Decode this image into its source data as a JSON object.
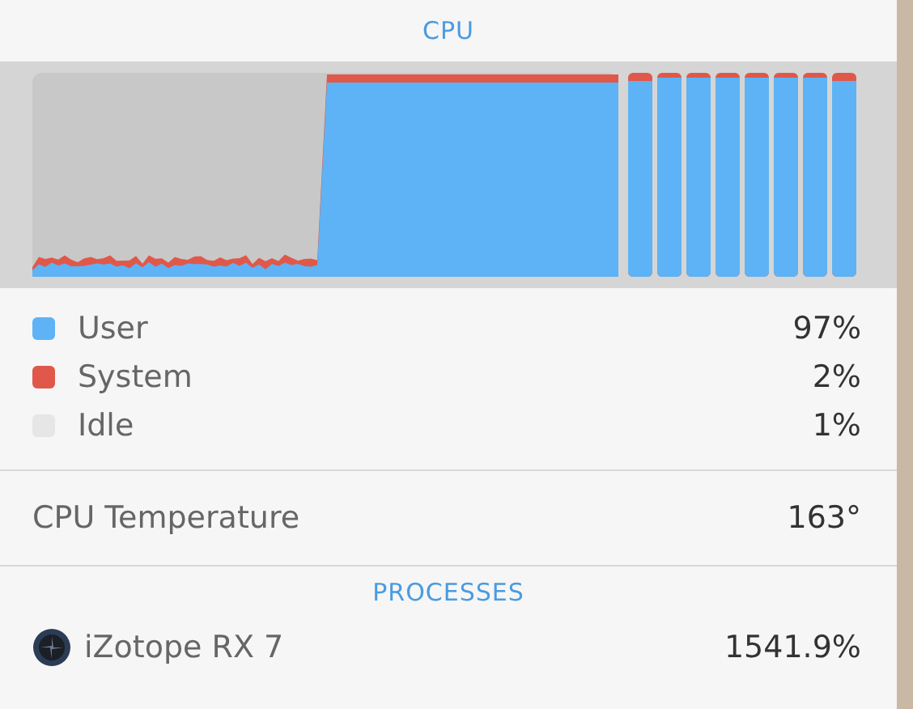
{
  "cpu": {
    "title": "CPU",
    "cores": [
      {
        "level": 0.96
      },
      {
        "level": 0.98
      },
      {
        "level": 0.98
      },
      {
        "level": 0.98
      },
      {
        "level": 0.98
      },
      {
        "level": 0.98
      },
      {
        "level": 0.98
      },
      {
        "level": 0.96
      }
    ],
    "legend": [
      {
        "label": "User",
        "color": "#5db3f5",
        "value": "97%"
      },
      {
        "label": "System",
        "color": "#e0584a",
        "value": "2%"
      },
      {
        "label": "Idle",
        "color": "#e6e6e6",
        "value": "1%"
      }
    ]
  },
  "temperature": {
    "label": "CPU Temperature",
    "value": "163°"
  },
  "processes": {
    "title": "PROCESSES",
    "items": [
      {
        "name": "iZotope RX 7",
        "value": "1541.9%"
      }
    ]
  }
}
